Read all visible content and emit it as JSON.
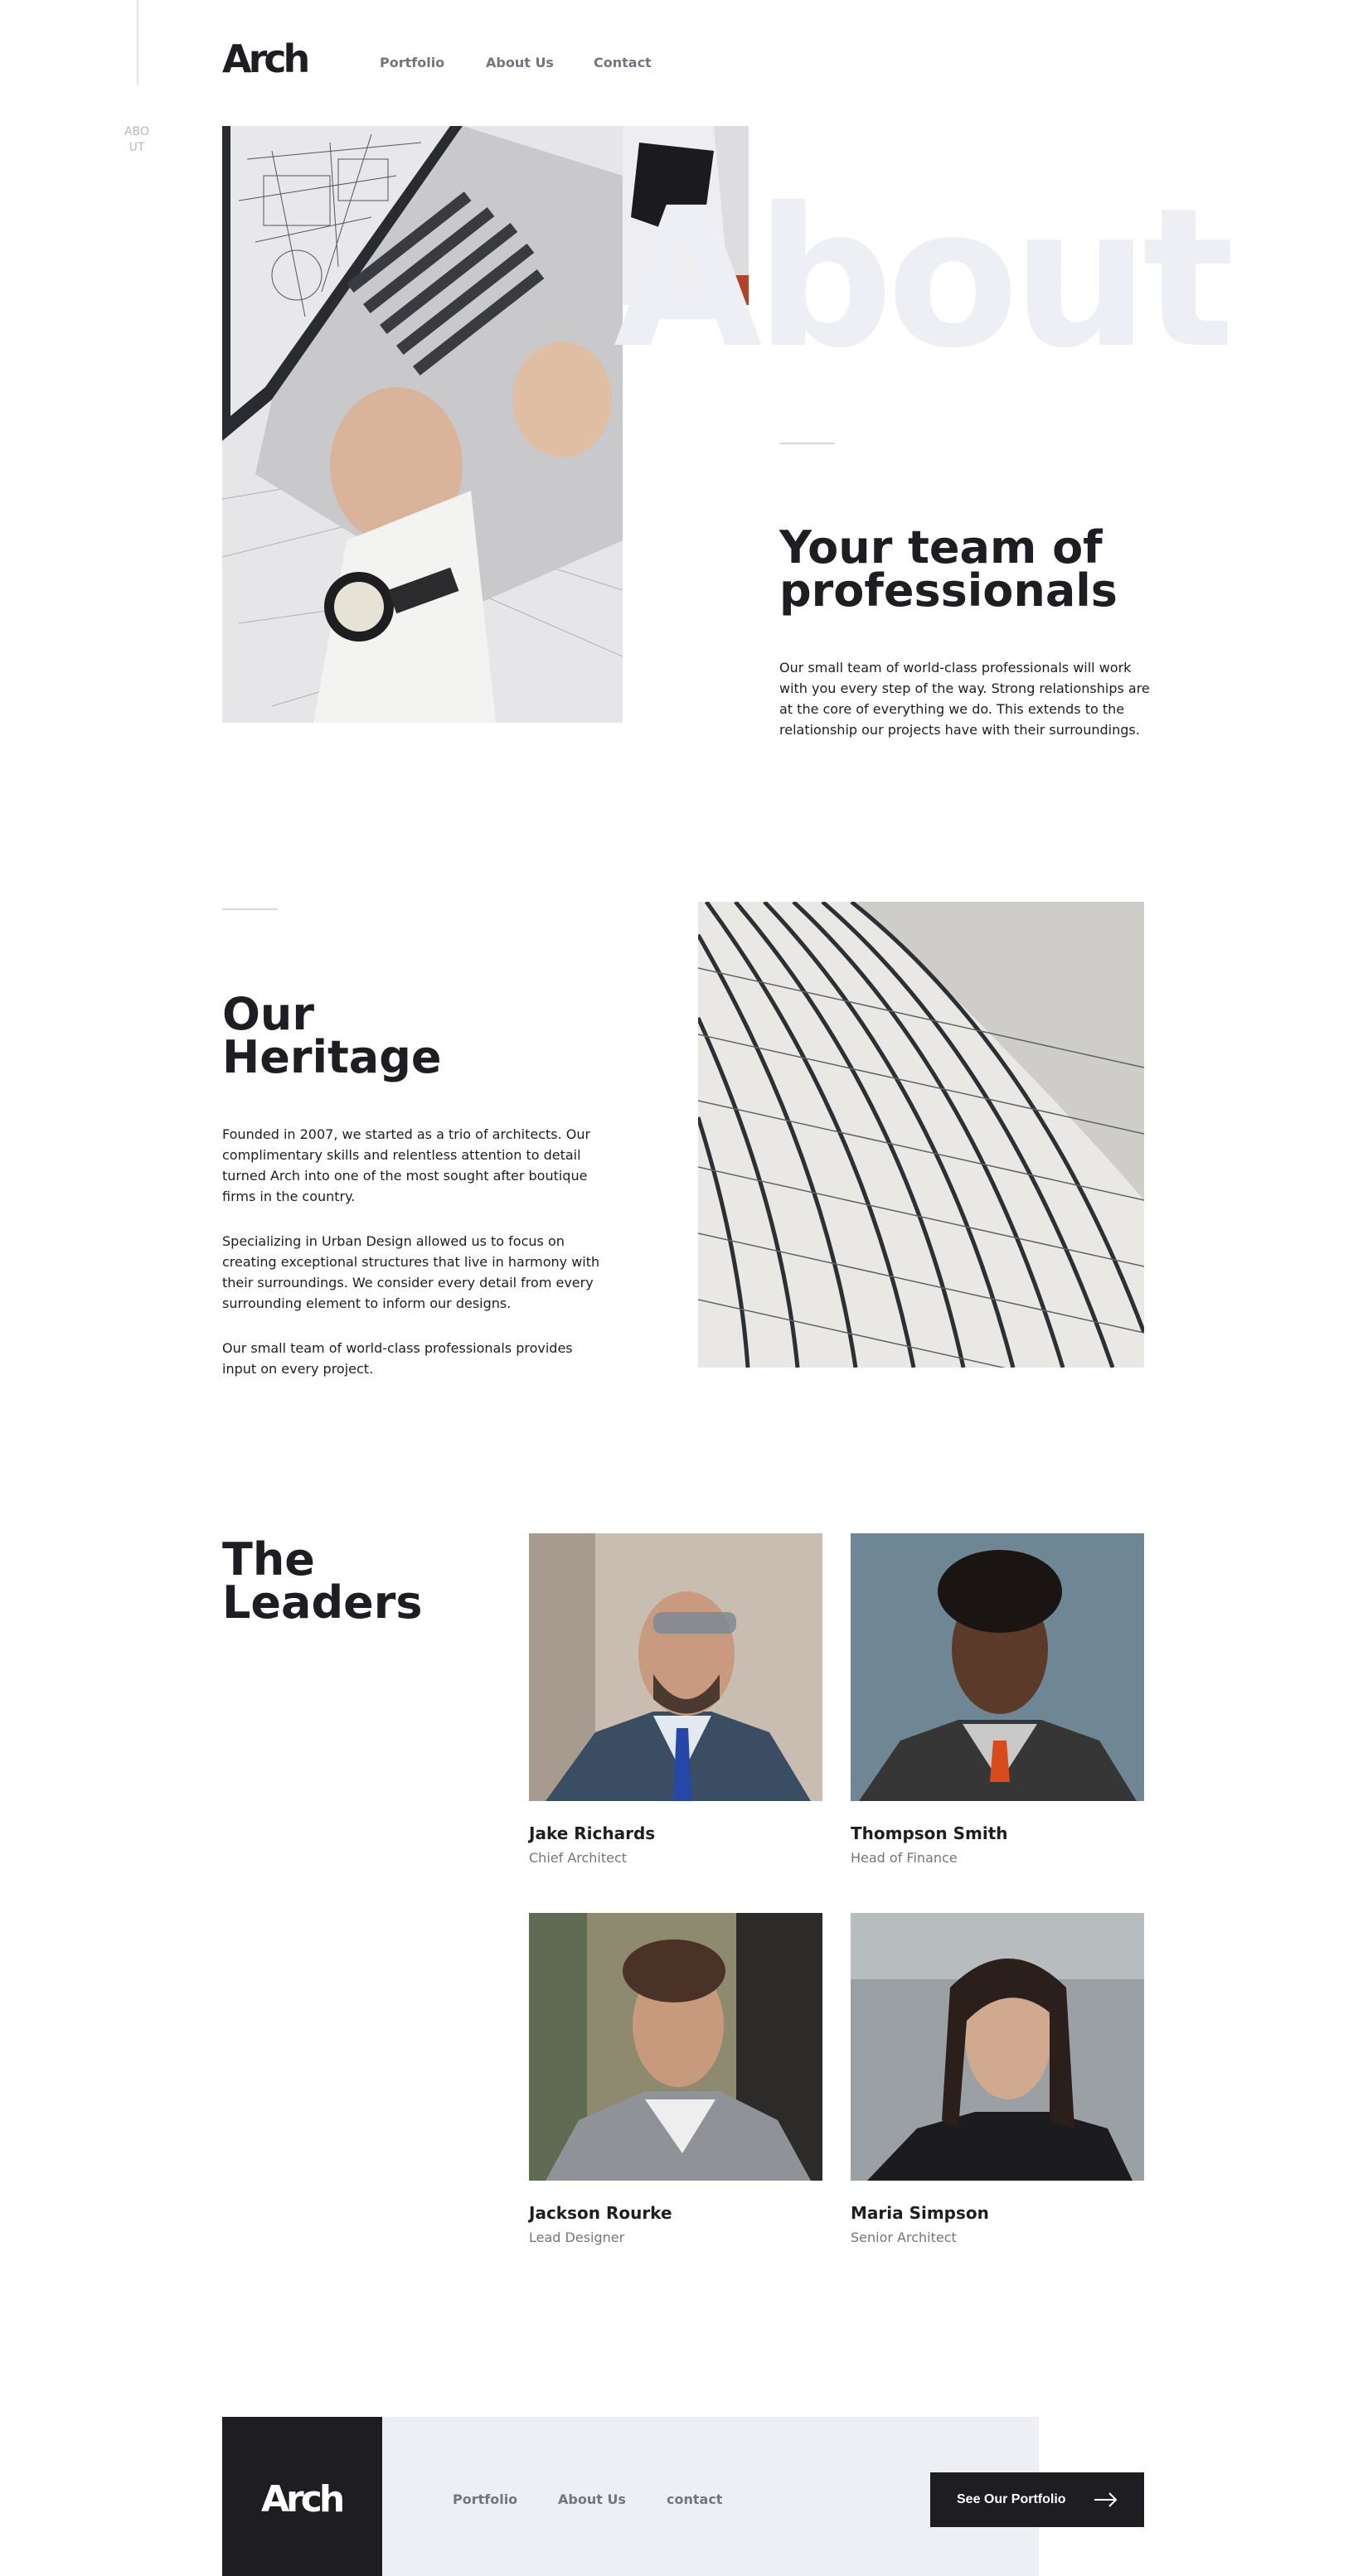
{
  "brand": {
    "logo": "Arch"
  },
  "side_label": "ABOUT",
  "nav": {
    "portfolio": "Portfolio",
    "about": "About Us",
    "contact": "Contact"
  },
  "hero": {
    "bg_word": "About",
    "title_line1": "Your team of",
    "title_line2": "professionals",
    "text": "Our small team of world-class professionals will work with you every step of the way. Strong relationships are at the core of everything we do. This extends to the relationship our projects have with their surroundings."
  },
  "heritage": {
    "title_line1": "Our",
    "title_line2": "Heritage",
    "p1": "Founded in 2007, we started as a trio of architects. Our complimentary skills and relentless attention to detail turned Arch into one of the most sought after boutique firms in the country.",
    "p2": "Specializing in Urban Design allowed us to focus on creating exceptional structures that live in harmony with their surroundings. We consider every detail from every surrounding element to inform our designs.",
    "p3": "Our small team of world-class professionals provides input on every project."
  },
  "leaders": {
    "title_line1": "The",
    "title_line2": "Leaders",
    "people": [
      {
        "name": "Jake Richards",
        "role": "Chief Architect"
      },
      {
        "name": "Thompson Smith",
        "role": "Head of Finance"
      },
      {
        "name": "Jackson Rourke",
        "role": "Lead Designer"
      },
      {
        "name": "Maria Simpson",
        "role": "Senior Architect"
      }
    ]
  },
  "footer": {
    "logo": "Arch",
    "nav": {
      "portfolio": "Portfolio",
      "about": "About Us",
      "contact": "contact"
    },
    "cta_label": "See Our Portfolio",
    "cta_icon": "arrow-right-icon"
  },
  "colors": {
    "dark": "#1d1d22",
    "muted": "#73747f",
    "light_bg": "#eeeff4"
  }
}
